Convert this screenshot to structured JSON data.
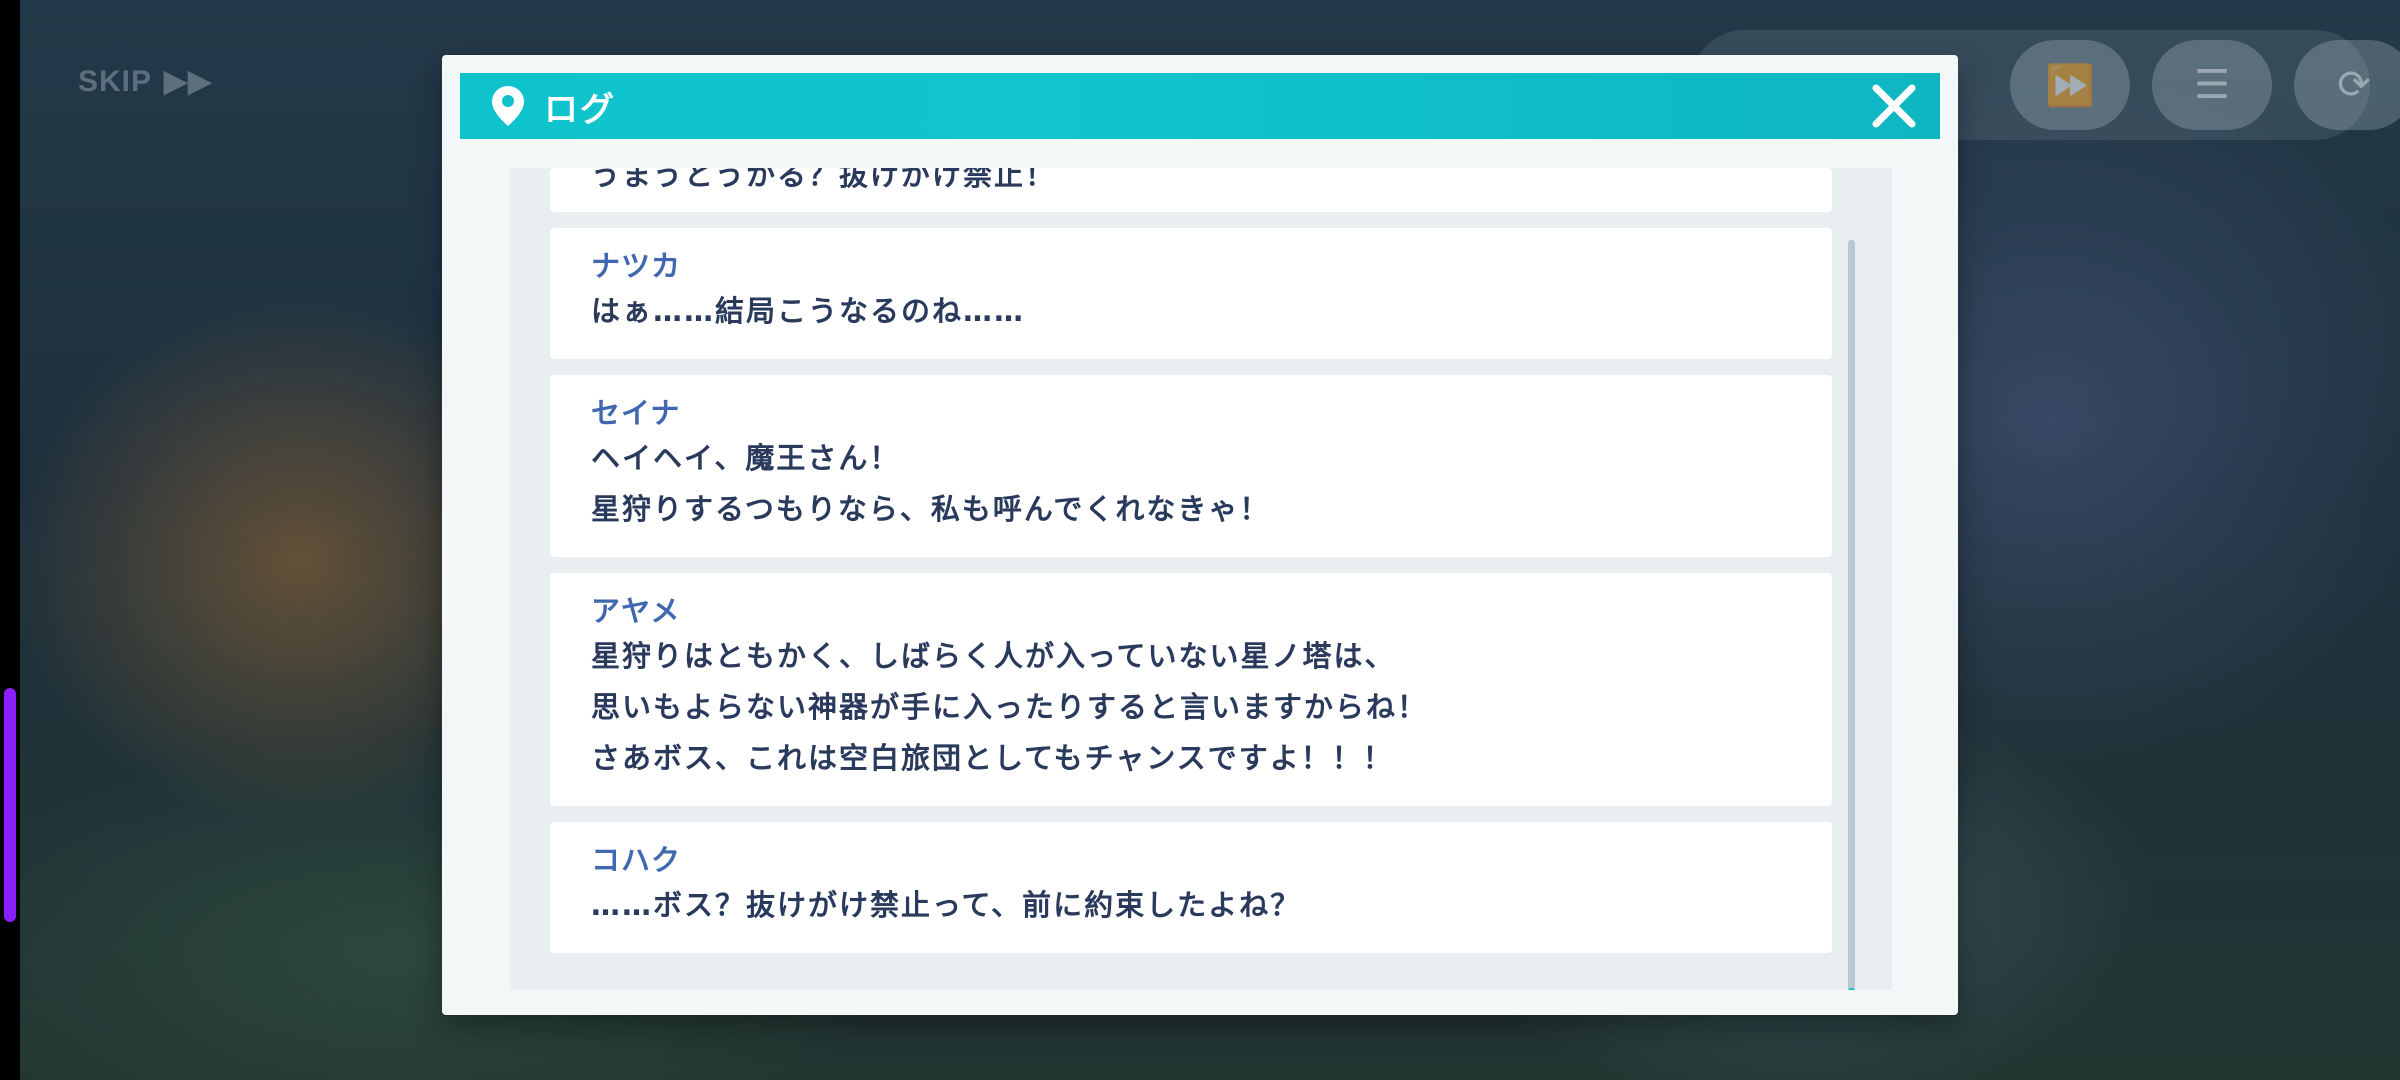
{
  "hud": {
    "skip_label": "SKIP",
    "skip_icon": "▶▶",
    "buttons": [
      {
        "icon": "fast-forward-icon",
        "glyph": "⏩"
      },
      {
        "icon": "menu-icon",
        "glyph": "☰"
      },
      {
        "icon": "auto-icon",
        "glyph": "⟳"
      }
    ]
  },
  "modal": {
    "title": "ログ",
    "close_icon": "close-icon",
    "header_color": "#10c5ce"
  },
  "log": {
    "partial_entry": "うまうとうかる？抜けがけ禁止！",
    "entries": [
      {
        "speaker": "ナツカ",
        "lines": [
          "はぁ……結局こうなるのね……"
        ]
      },
      {
        "speaker": "セイナ",
        "lines": [
          "ヘイヘイ、魔王さん！",
          "星狩りするつもりなら、私も呼んでくれなきゃ！"
        ]
      },
      {
        "speaker": "アヤメ",
        "lines": [
          "星狩りはともかく、しばらく人が入っていない星ノ塔は、",
          "思いもよらない神器が手に入ったりすると言いますからね！",
          "さあボス、これは空白旅団としてもチャンスですよ！！！"
        ]
      },
      {
        "speaker": "コハク",
        "lines": [
          "……ボス？抜けがけ禁止って、前に約束したよね？"
        ]
      }
    ]
  },
  "colors": {
    "speaker": "#3f68b0",
    "text": "#2a3a5c",
    "accent": "#14c0cb"
  }
}
